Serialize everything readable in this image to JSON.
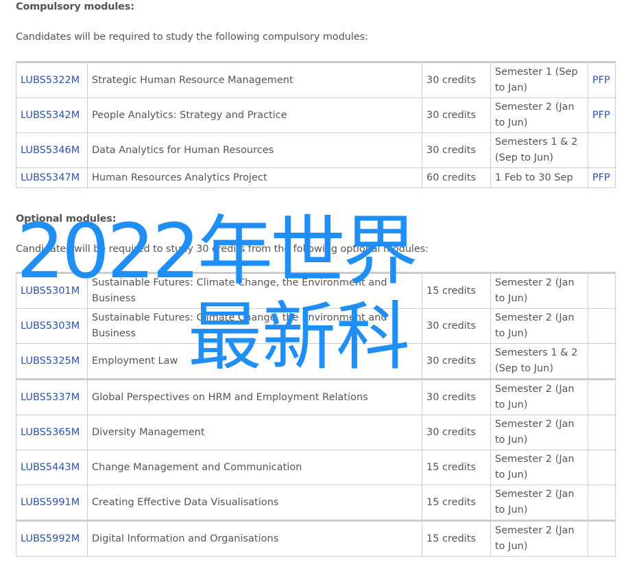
{
  "compulsory": {
    "heading": "Compulsory modules:",
    "intro": "Candidates will be required to study the following compulsory modules:",
    "rows": [
      {
        "code": "LUBS5322M",
        "title": "Strategic Human Resource Management",
        "credits": "30 credits",
        "semester": "Semester 1 (Sep to Jan)",
        "pfp": "PFP"
      },
      {
        "code": "LUBS5342M",
        "title": "People Analytics: Strategy and Practice",
        "credits": "30 credits",
        "semester": "Semester 2 (Jan to Jun)",
        "pfp": "PFP"
      },
      {
        "code": "LUBS5346M",
        "title": "Data Analytics for Human Resources",
        "credits": "30 credits",
        "semester": "Semesters 1 & 2 (Sep to Jun)",
        "pfp": ""
      },
      {
        "code": "LUBS5347M",
        "title": "Human Resources Analytics Project",
        "credits": "60 credits",
        "semester": "1 Feb to 30 Sep",
        "pfp": "PFP"
      }
    ]
  },
  "optional": {
    "heading": "Optional modules:",
    "intro": "Candidates will be required to study 30 credits from the following optional modules:",
    "rows": [
      {
        "code": "LUBS5301M",
        "title": "Sustainable Futures: Climate Change, the Environment and Business",
        "credits": "15 credits",
        "semester": "Semester 2 (Jan to Jun)",
        "pfp": ""
      },
      {
        "code": "LUBS5303M",
        "title": "Sustainable Futures: Climate Change, the Environment and Business",
        "credits": "30 credits",
        "semester": "Semester 2 (Jan to Jun)",
        "pfp": ""
      },
      {
        "code": "LUBS5325M",
        "title": "Employment Law",
        "credits": "30 credits",
        "semester": "Semesters 1 & 2 (Sep to Jun)",
        "pfp": ""
      },
      {
        "code": "LUBS5337M",
        "title": "Global Perspectives on HRM and Employment Relations",
        "credits": "30 credits",
        "semester": "Semester 2 (Jan to Jun)",
        "pfp": ""
      },
      {
        "code": "LUBS5365M",
        "title": "Diversity Management",
        "credits": "30 credits",
        "semester": "Semester 2 (Jan to Jun)",
        "pfp": ""
      },
      {
        "code": "LUBS5443M",
        "title": "Change Management and Communication",
        "credits": "15 credits",
        "semester": "Semester 2 (Jan to Jun)",
        "pfp": ""
      },
      {
        "code": "LUBS5991M",
        "title": "Creating Effective Data Visualisations",
        "credits": "15 credits",
        "semester": "Semester 2 (Jan to Jun)",
        "pfp": ""
      },
      {
        "code": "LUBS5992M",
        "title": "Digital Information and Organisations",
        "credits": "15 credits",
        "semester": "Semester 2 (Jan to Jun)",
        "pfp": ""
      }
    ]
  },
  "watermark": {
    "line1": "2022年世界",
    "line2": "最新科",
    "color": "#1f8ef5"
  },
  "colors": {
    "text": "#555555",
    "link": "#2b52b0",
    "border": "#cccccc"
  }
}
